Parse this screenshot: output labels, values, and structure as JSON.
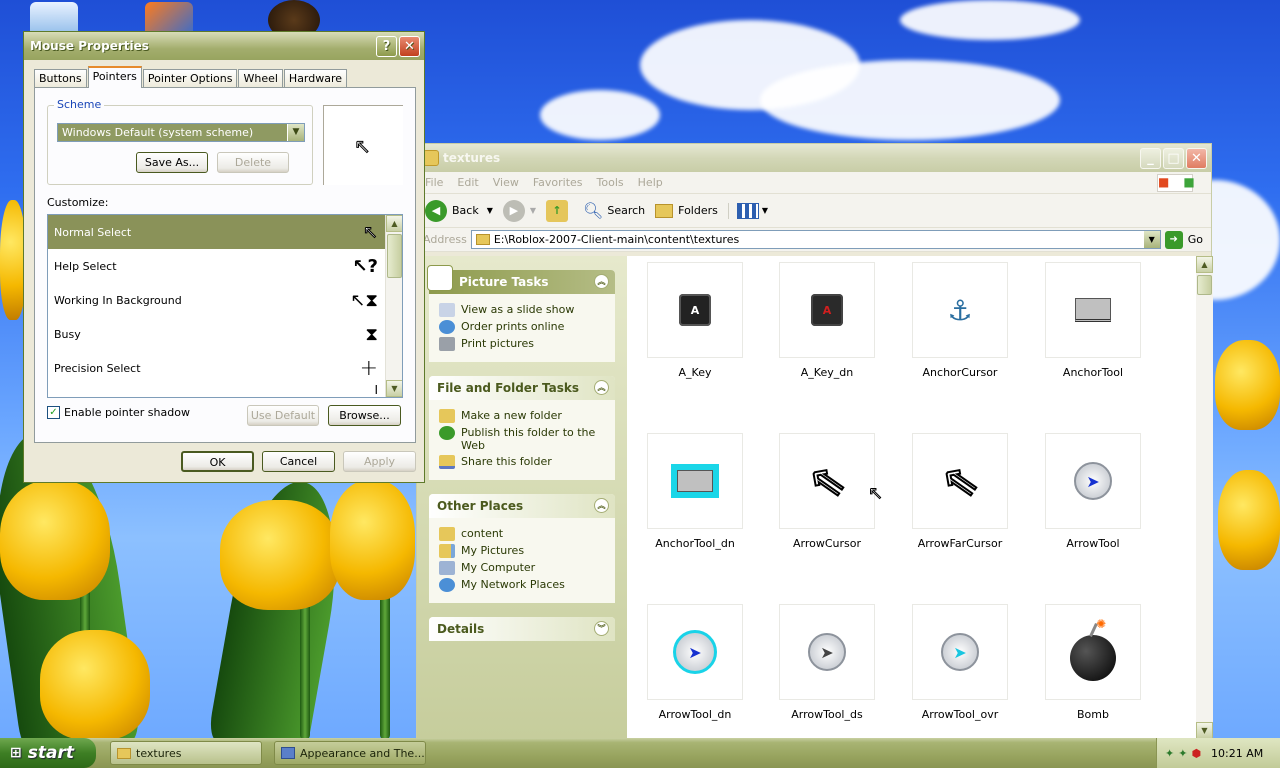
{
  "mouse_dialog": {
    "title": "Mouse Properties",
    "tabs": [
      "Buttons",
      "Pointers",
      "Pointer Options",
      "Wheel",
      "Hardware"
    ],
    "active_tab": "Pointers",
    "scheme_label": "Scheme",
    "scheme_value": "Windows Default (system scheme)",
    "save_as": "Save As...",
    "delete": "Delete",
    "customize_label": "Customize:",
    "pointers": [
      {
        "name": "Normal Select",
        "glyph": "↖"
      },
      {
        "name": "Help Select",
        "glyph": "↖?"
      },
      {
        "name": "Working In Background",
        "glyph": "↖⧗"
      },
      {
        "name": "Busy",
        "glyph": "⧗"
      },
      {
        "name": "Precision Select",
        "glyph": "+"
      }
    ],
    "partial_glyph": "I",
    "preview_glyph": "↖",
    "shadow_label": "Enable pointer shadow",
    "shadow_checked": true,
    "use_default": "Use Default",
    "browse": "Browse...",
    "ok": "OK",
    "cancel": "Cancel",
    "apply": "Apply"
  },
  "explorer": {
    "title": "textures",
    "menu": [
      "File",
      "Edit",
      "View",
      "Favorites",
      "Tools",
      "Help"
    ],
    "back": "Back",
    "search": "Search",
    "folders": "Folders",
    "address_label": "Address",
    "address": "E:\\Roblox-2007-Client-main\\content\\textures",
    "go": "Go",
    "picture_tasks": {
      "title": "Picture Tasks",
      "links": [
        "View as a slide show",
        "Order prints online",
        "Print pictures"
      ]
    },
    "file_tasks": {
      "title": "File and Folder Tasks",
      "links": [
        "Make a new folder",
        "Publish this folder to the Web",
        "Share this folder"
      ]
    },
    "other_places": {
      "title": "Other Places",
      "links": [
        "content",
        "My Pictures",
        "My Computer",
        "My Network Places"
      ]
    },
    "details": "Details",
    "files": [
      "A_Key",
      "A_Key_dn",
      "AnchorCursor",
      "AnchorTool",
      "AnchorTool_dn",
      "ArrowCursor",
      "ArrowFarCursor",
      "ArrowTool",
      "ArrowTool_dn",
      "ArrowTool_ds",
      "ArrowTool_ovr",
      "Bomb"
    ]
  },
  "taskbar": {
    "start": "start",
    "tasks": [
      "textures",
      "Appearance and The..."
    ],
    "clock": "10:21 AM"
  },
  "colors": {
    "titlebar": "#98a45f",
    "selection": "#8a9259",
    "taskbar": "#98a45f"
  }
}
